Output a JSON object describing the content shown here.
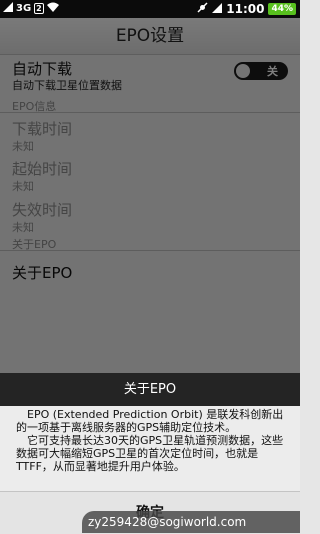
{
  "status_bar": {
    "network": "3G",
    "sim": "2",
    "time": "11:00",
    "battery": "44%"
  },
  "title": "EPO设置",
  "auto_download": {
    "label": "自动下载",
    "sublabel": "自动下载卫星位置数据",
    "toggle_text": "关",
    "enabled": false
  },
  "epo_info": {
    "header": "EPO信息",
    "items": [
      {
        "label": "下载时间",
        "value": "未知"
      },
      {
        "label": "起始时间",
        "value": "未知"
      },
      {
        "label": "失效时间",
        "value": "未知"
      }
    ]
  },
  "about": {
    "header": "关于EPO",
    "item": "关于EPO"
  },
  "dialog": {
    "title": "关于EPO",
    "para1": "EPO (Extended Prediction Orbit) 是联发科创新出的一项基于离线服务器的GPS辅助定位技术。",
    "para2": "它可支持最长达30天的GPS卫星轨道预测数据，这些数据可大幅缩短GPS卫星的首次定位时间，也就是TTFF，从而显著地提升用户体验。",
    "ok": "确定"
  },
  "watermark": "zy259428@sogiworld.com"
}
